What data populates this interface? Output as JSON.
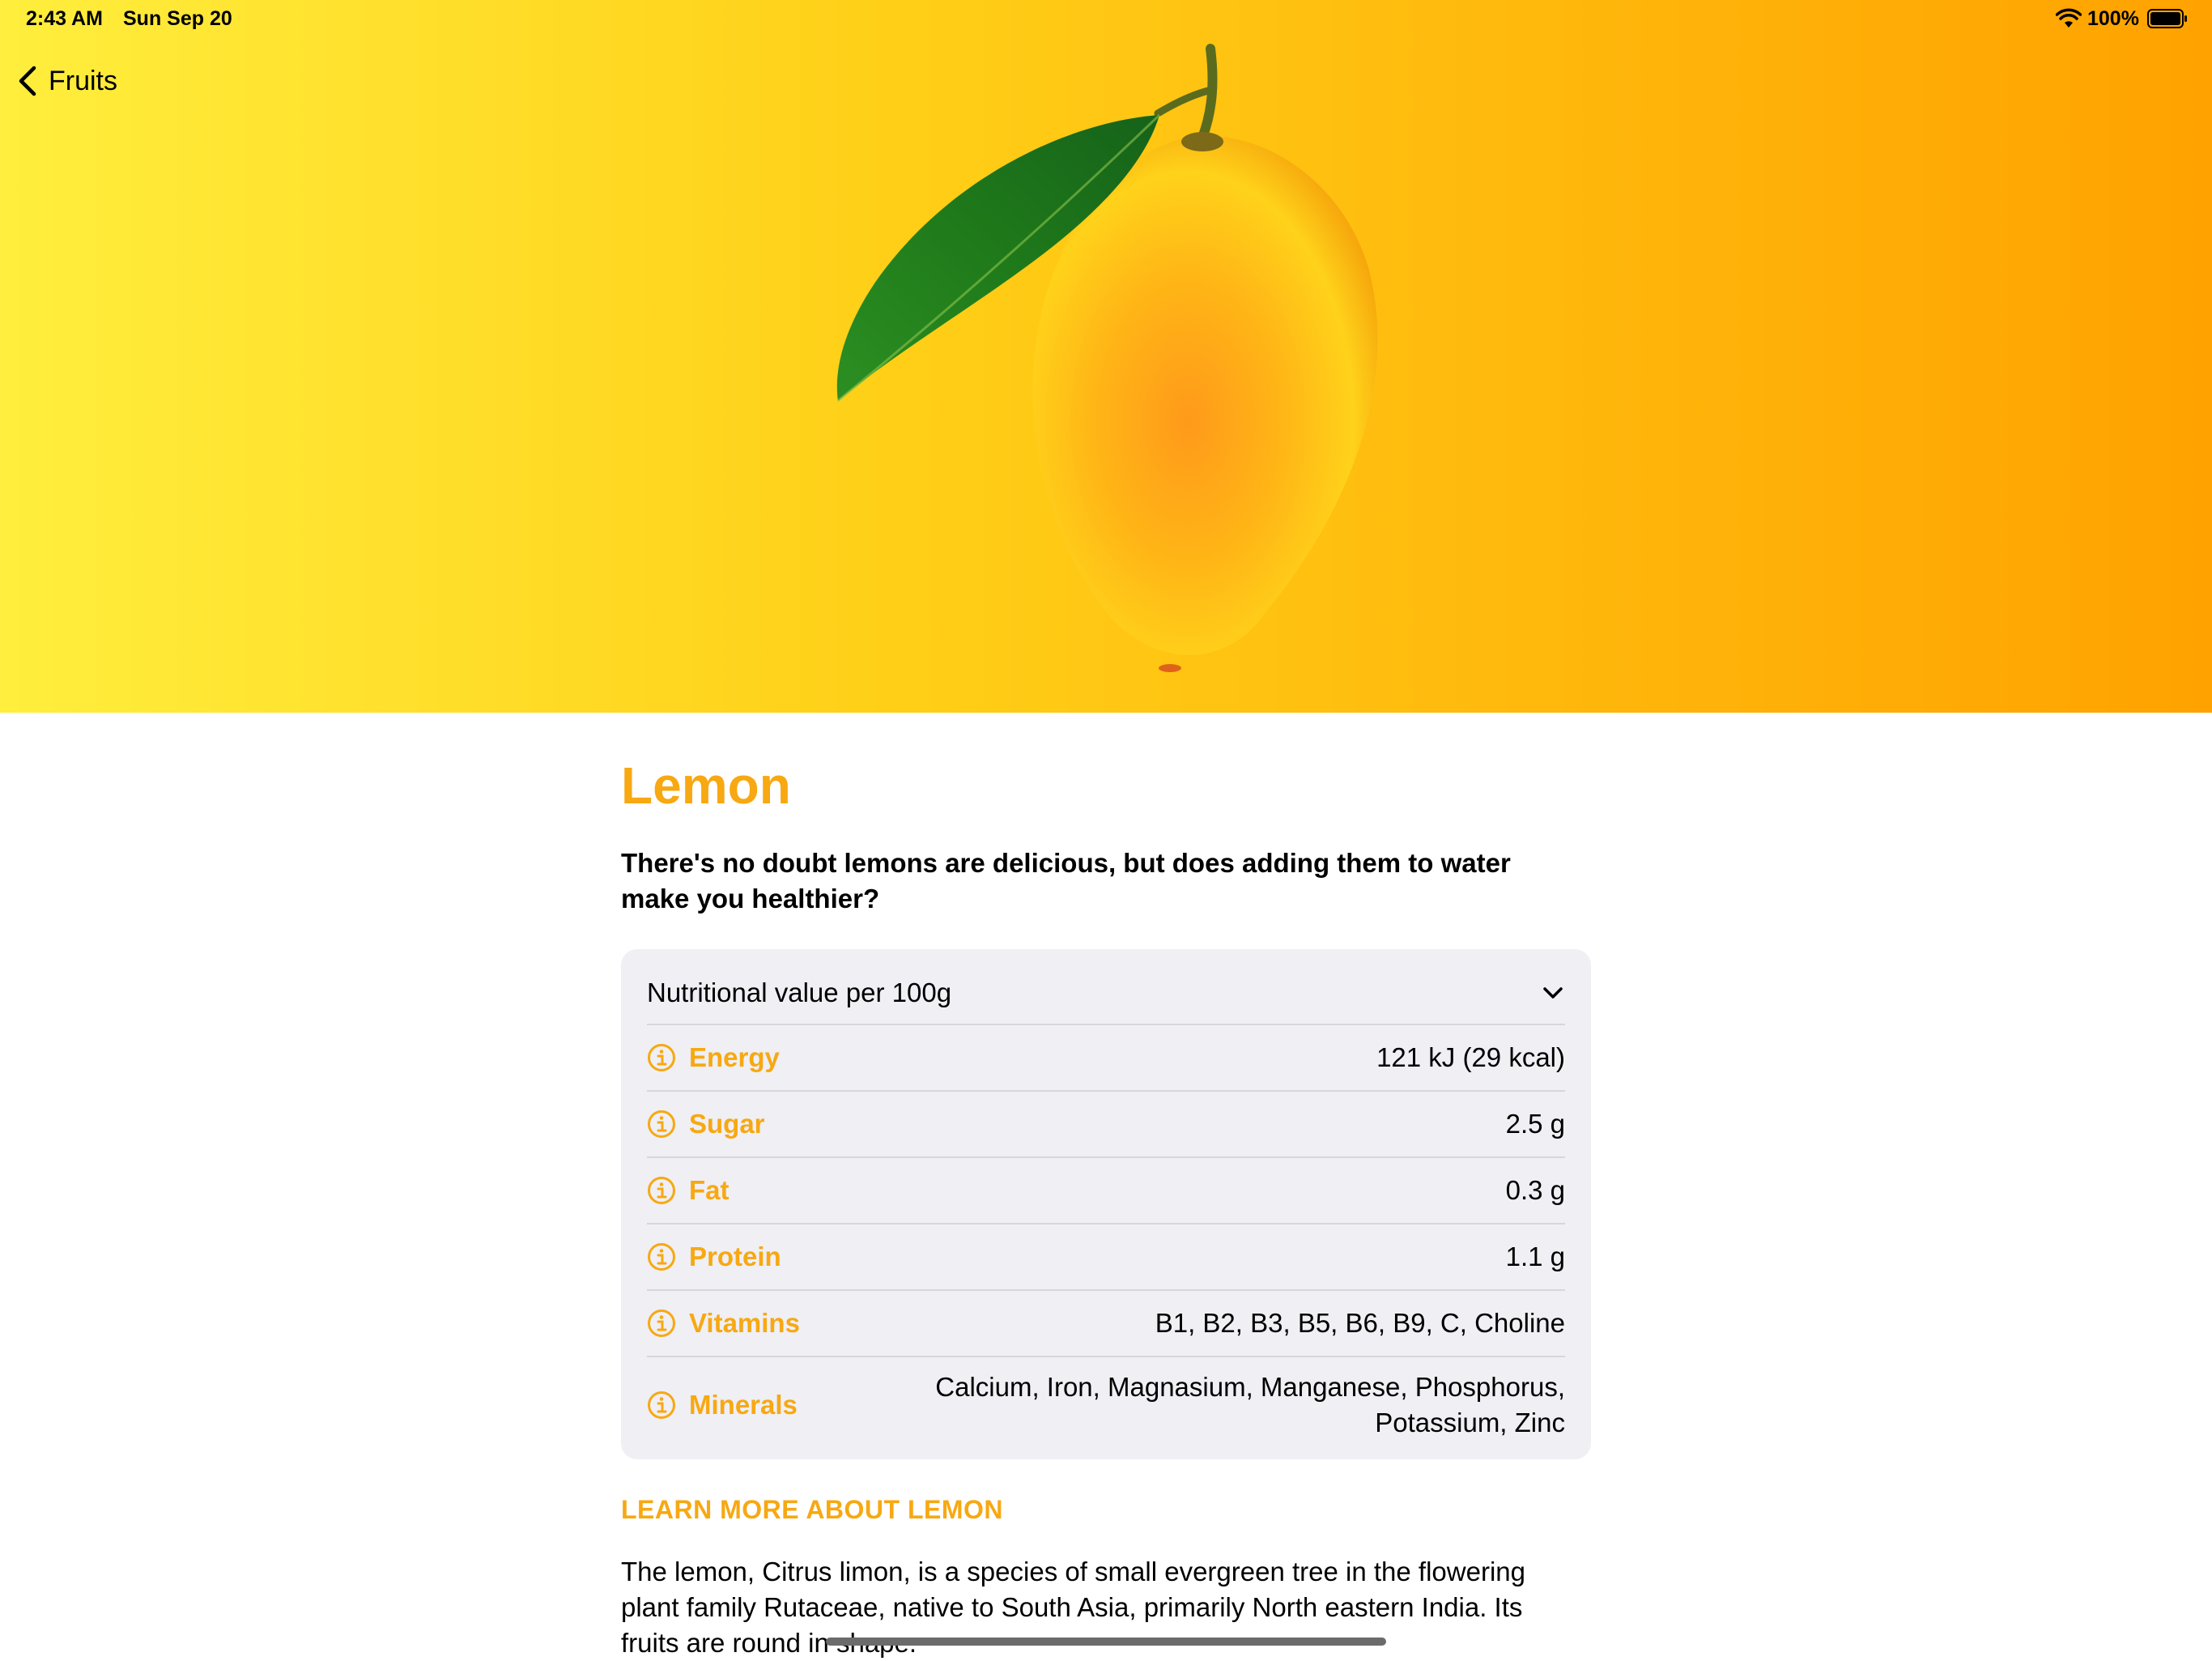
{
  "status_bar": {
    "time": "2:43 AM",
    "date": "Sun Sep 20",
    "battery": "100%",
    "icons": [
      "wifi-icon",
      "battery-icon"
    ]
  },
  "nav": {
    "back_label": "Fruits",
    "back_icon": "chevron-left-icon"
  },
  "hero": {
    "image": "lemon-with-leaf",
    "gradient": [
      "#ffee3d",
      "#ffcf17",
      "#ffb40a",
      "#ffa200"
    ]
  },
  "fruit": {
    "title": "Lemon",
    "headline": "There's no doubt lemons are delicious, but does adding them to water make you healthier?",
    "accent_color": "#f7a812"
  },
  "nutrition": {
    "header": "Nutritional value per 100g",
    "expand_icon": "chevron-down-icon",
    "rows": [
      {
        "label": "Energy",
        "value": "121 kJ (29 kcal)"
      },
      {
        "label": "Sugar",
        "value": "2.5 g"
      },
      {
        "label": "Fat",
        "value": "0.3 g"
      },
      {
        "label": "Protein",
        "value": "1.1 g"
      },
      {
        "label": "Vitamins",
        "value": "B1, B2, B3, B5, B6, B9, C, Choline"
      },
      {
        "label": "Minerals",
        "value": "Calcium, Iron, Magnasium, Manganese, Phosphorus, Potassium, Zinc"
      }
    ]
  },
  "learn_more": "LEARN MORE ABOUT LEMON",
  "description": "The lemon, Citrus limon, is a species of small evergreen tree in the flowering plant family Rutaceae, native to South Asia, primarily North eastern India. Its fruits are round in shape."
}
